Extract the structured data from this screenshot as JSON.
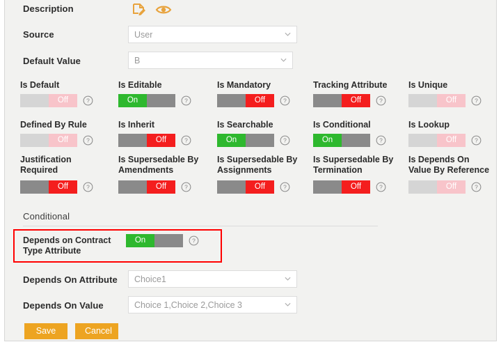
{
  "form": {
    "description": {
      "label": "Description",
      "icons": [
        {
          "name": "edit-document-icon",
          "color": "#e8a33d"
        },
        {
          "name": "eye-icon",
          "color": "#e8a33d"
        }
      ]
    },
    "source": {
      "label": "Source",
      "value": "User"
    },
    "default_value": {
      "label": "Default Value",
      "value": "B"
    }
  },
  "toggles": [
    {
      "label": "Is Default",
      "state": "Off",
      "enabled": false
    },
    {
      "label": "Is Editable",
      "state": "On",
      "enabled": true
    },
    {
      "label": "Is Mandatory",
      "state": "Off",
      "enabled": true
    },
    {
      "label": "Tracking Attribute",
      "state": "Off",
      "enabled": true
    },
    {
      "label": "Is Unique",
      "state": "Off",
      "enabled": false
    },
    {
      "label": "Defined By Rule",
      "state": "Off",
      "enabled": false
    },
    {
      "label": "Is Inherit",
      "state": "Off",
      "enabled": true
    },
    {
      "label": "Is Searchable",
      "state": "On",
      "enabled": true
    },
    {
      "label": "Is Conditional",
      "state": "On",
      "enabled": true
    },
    {
      "label": "Is Lookup",
      "state": "Off",
      "enabled": false
    },
    {
      "label": "Justification\nRequired",
      "state": "Off",
      "enabled": true
    },
    {
      "label": "Is Supersedable By\nAmendments",
      "state": "Off",
      "enabled": true
    },
    {
      "label": "Is Supersedable By\nAssignments",
      "state": "Off",
      "enabled": true
    },
    {
      "label": "Is Supersedable By\nTermination",
      "state": "Off",
      "enabled": true
    },
    {
      "label": "Is Depends On\nValue By Reference",
      "state": "Off",
      "enabled": false
    }
  ],
  "conditional": {
    "section_label": "Conditional",
    "depends_on_contract_type": {
      "label": "Depends on Contract\nType Attribute",
      "state": "On",
      "enabled": true
    },
    "depends_on_attribute": {
      "label": "Depends On Attribute",
      "value": "Choice1"
    },
    "depends_on_value": {
      "label": "Depends On Value",
      "value": "Choice 1,Choice 2,Choice 3"
    }
  },
  "actions": {
    "save_label": "Save",
    "cancel_label": "Cancel"
  },
  "colors": {
    "on": "#2eb82e",
    "off": "#f41e1e",
    "off_disabled": "#f8c4ca",
    "accent": "#eda421",
    "highlight": "#ff0000"
  }
}
